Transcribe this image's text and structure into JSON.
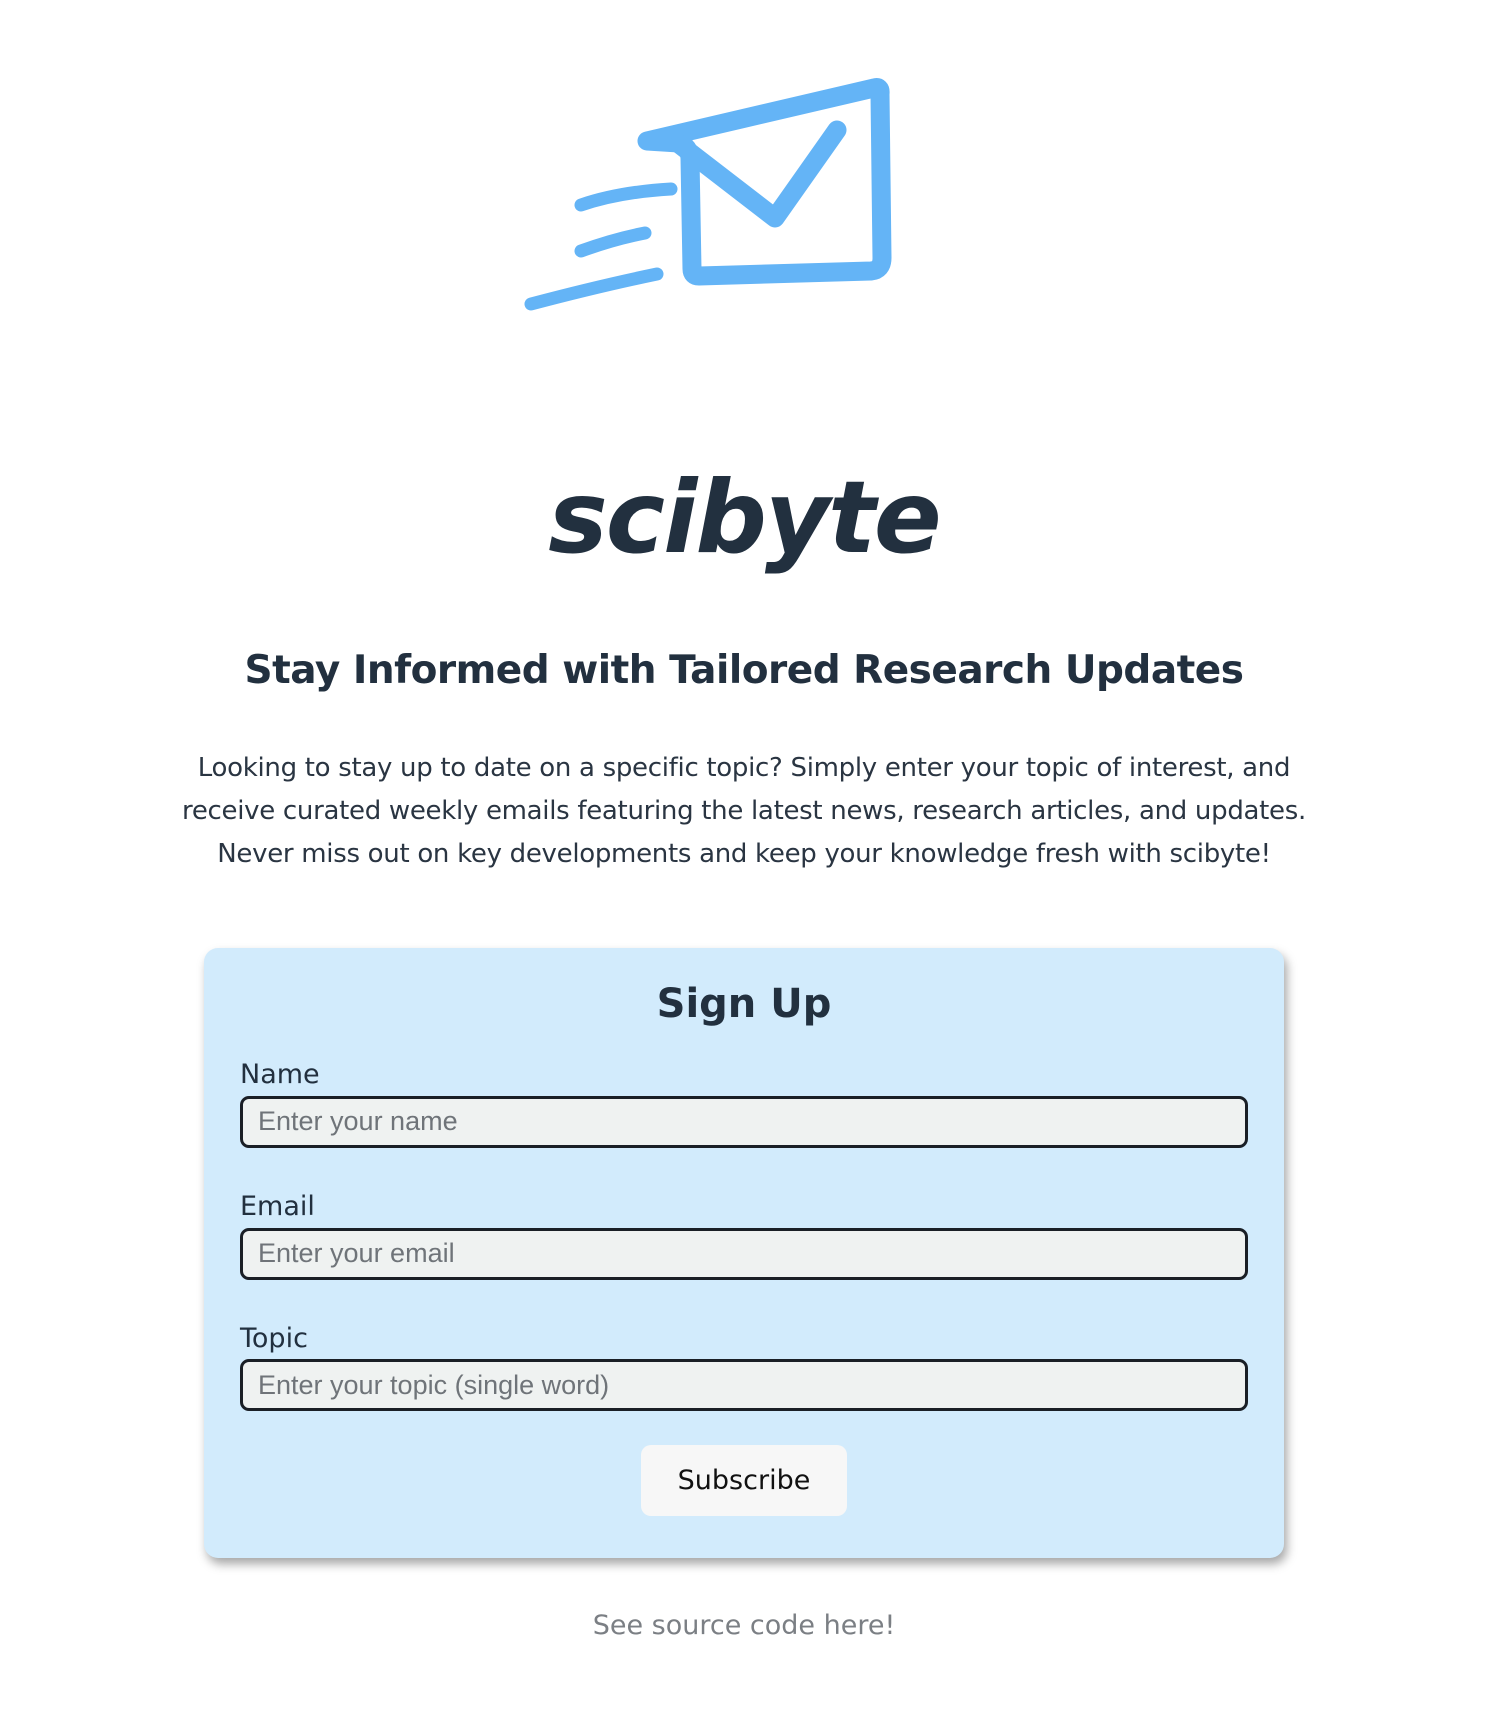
{
  "brand": {
    "logo_icon": "flying-envelope-icon",
    "name": "scibyte",
    "accent_color": "#64b4f6",
    "text_color": "#22303f"
  },
  "hero": {
    "headline": "Stay Informed with Tailored Research Updates",
    "description": "Looking to stay up to date on a specific topic? Simply enter your topic of interest, and receive curated weekly emails featuring the latest news, research articles, and updates. Never miss out on key developments and keep your knowledge fresh with scibyte!"
  },
  "signup": {
    "title": "Sign Up",
    "card_color": "#d2ebfc",
    "fields": {
      "name": {
        "label": "Name",
        "placeholder": "Enter your name",
        "value": ""
      },
      "email": {
        "label": "Email",
        "placeholder": "Enter your email",
        "value": ""
      },
      "topic": {
        "label": "Topic",
        "placeholder": "Enter your topic (single word)",
        "value": ""
      }
    },
    "submit_label": "Subscribe"
  },
  "footer": {
    "source_link": "See source code here!"
  }
}
